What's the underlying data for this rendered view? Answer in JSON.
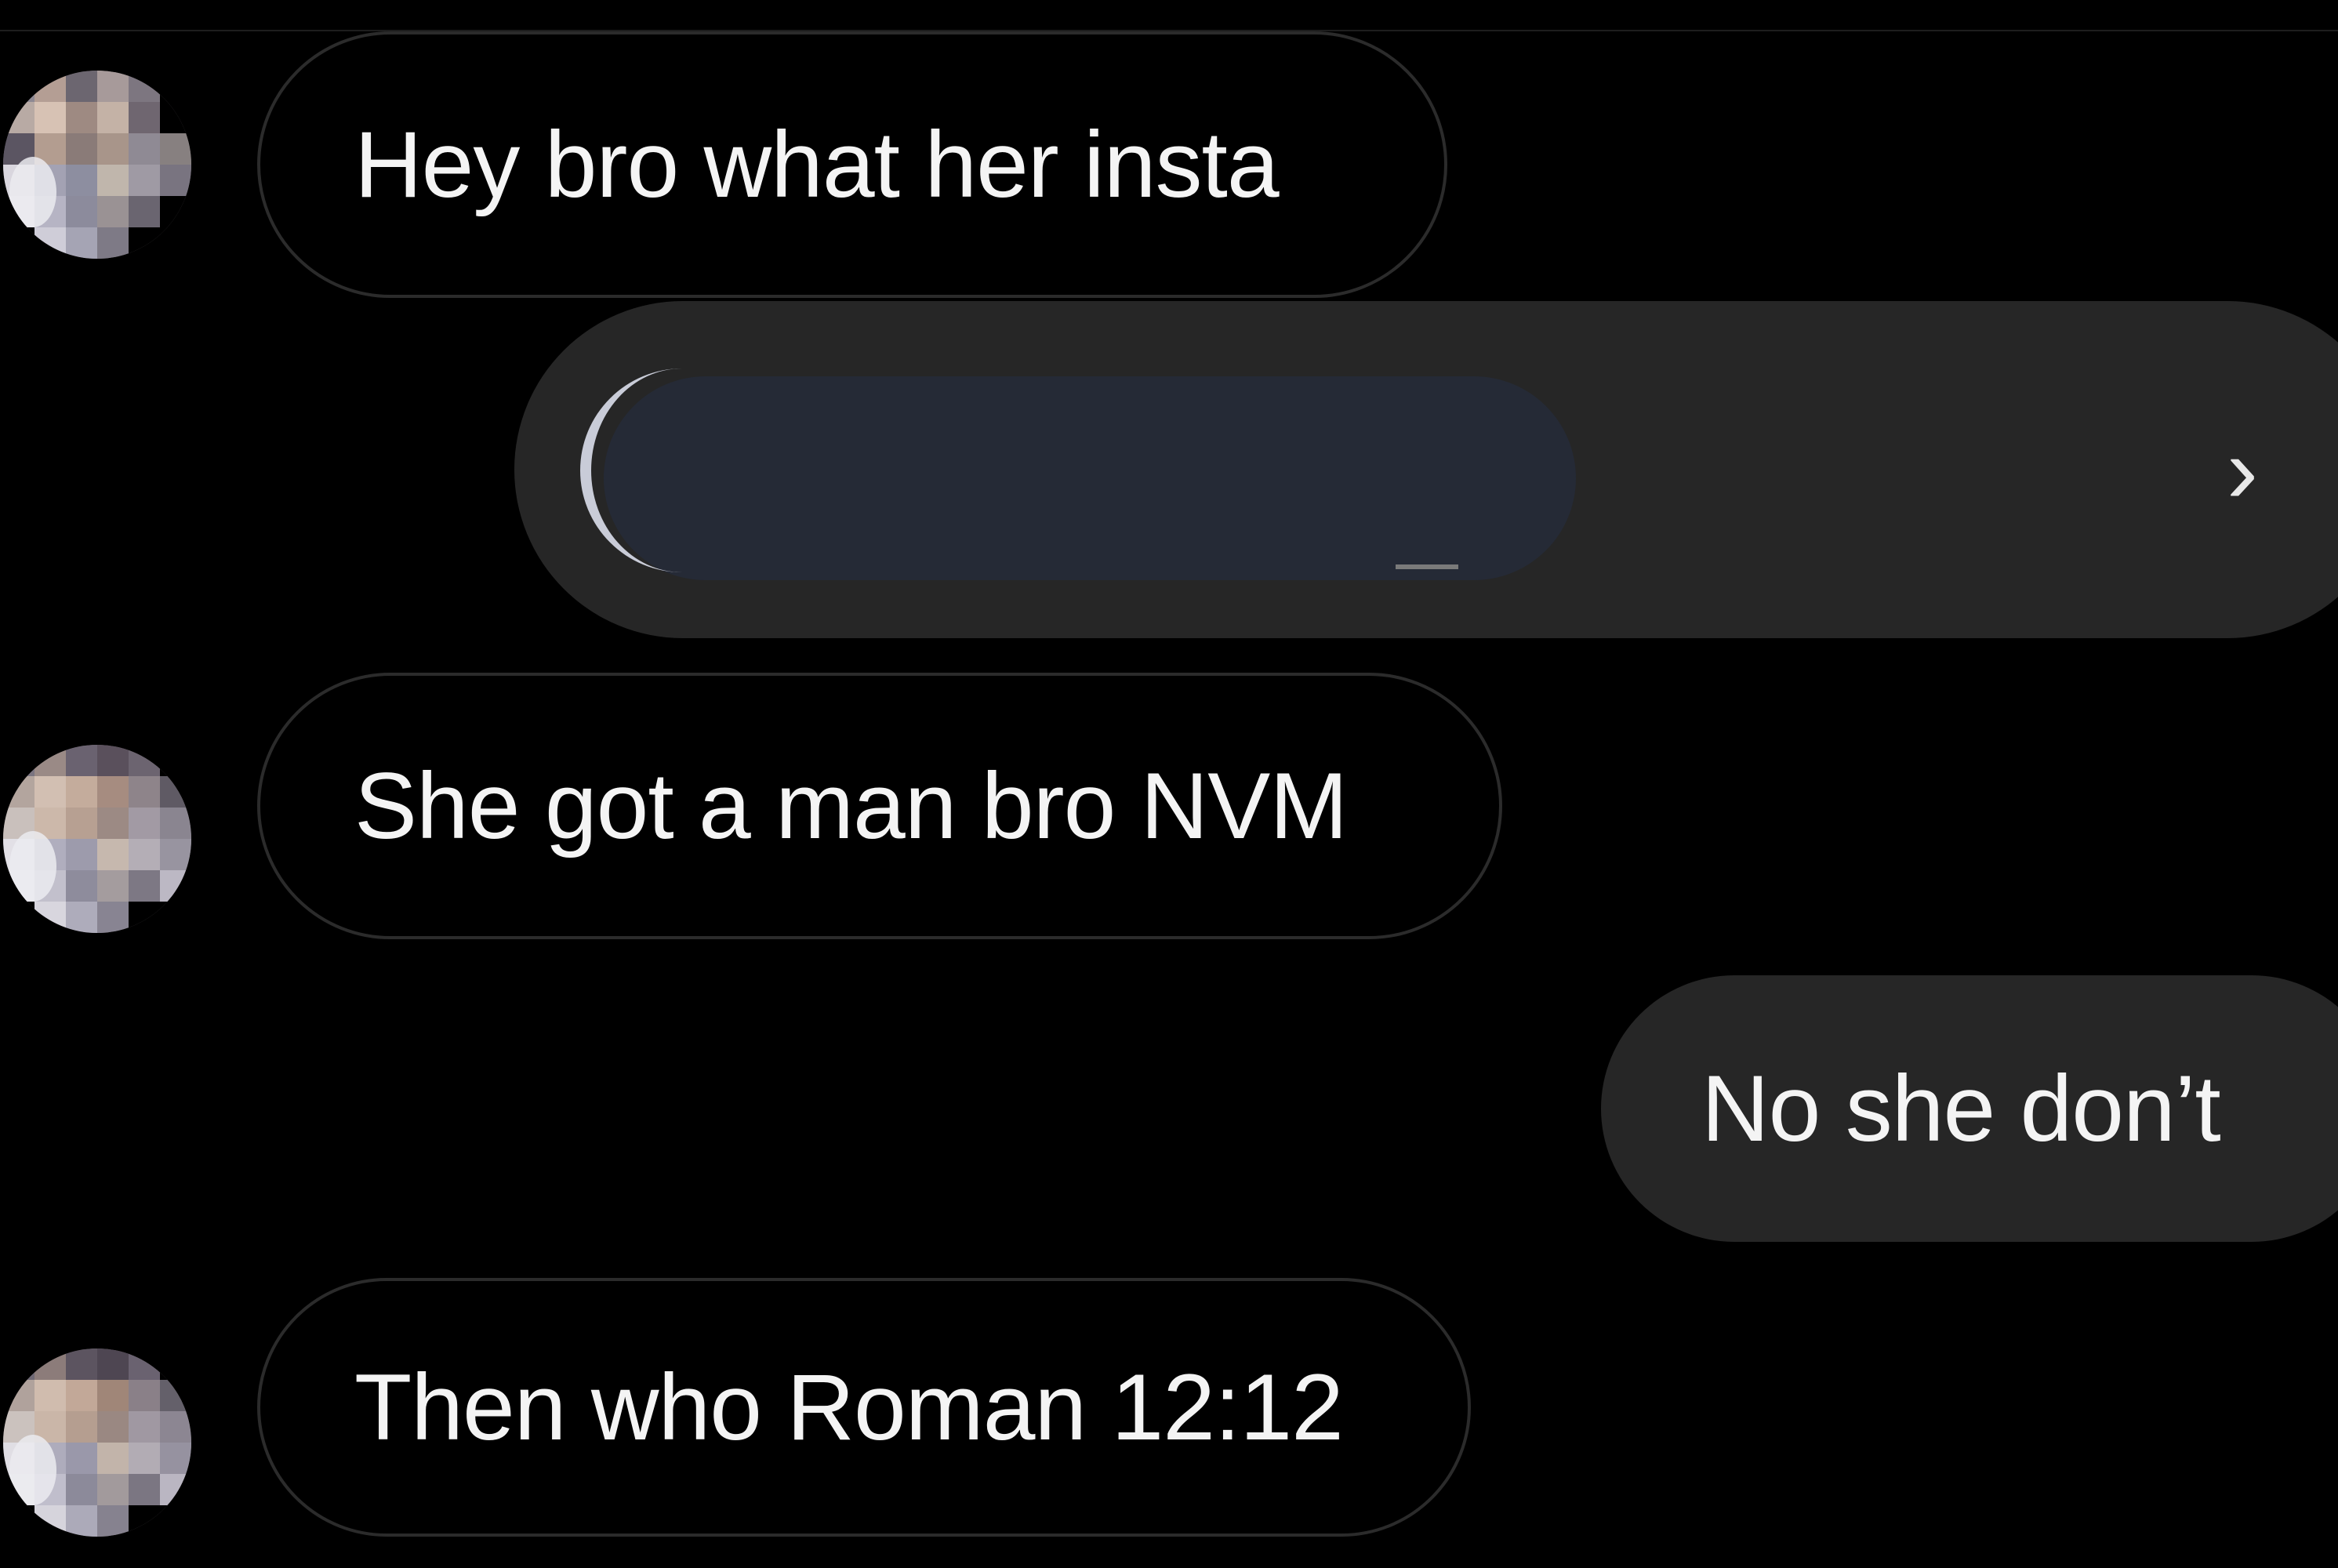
{
  "messages": [
    {
      "direction": "incoming",
      "text": "Hey bro what her insta"
    },
    {
      "direction": "outgoing",
      "type": "profile-share",
      "chevron": "›"
    },
    {
      "direction": "incoming",
      "text": "She got a man bro NVM"
    },
    {
      "direction": "outgoing",
      "text": "No she don’t"
    },
    {
      "direction": "incoming",
      "text": "Then who Roman 12:12"
    }
  ],
  "icons": {
    "avatar": "sender-avatar-icon",
    "chevron": "chevron-right-icon"
  },
  "colors": {
    "background": "#000000",
    "outgoing_bubble": "#262626",
    "incoming_border": "#2b2b2b",
    "text": "#f4f4f4"
  }
}
